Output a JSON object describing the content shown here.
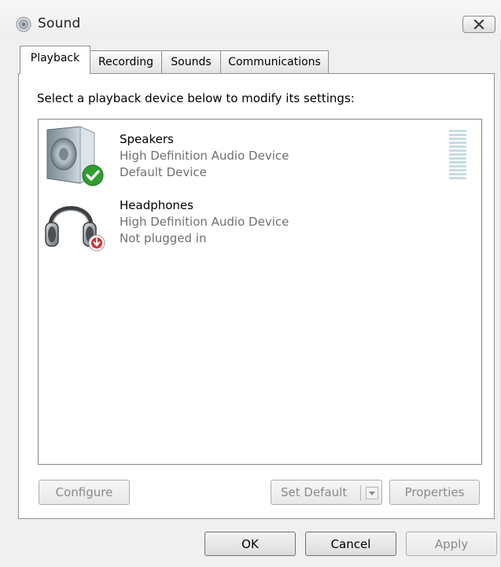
{
  "window": {
    "title": "Sound",
    "title_icon": "speaker-icon",
    "close_icon": "close-icon"
  },
  "tabs": [
    {
      "label": "Playback",
      "active": true
    },
    {
      "label": "Recording",
      "active": false
    },
    {
      "label": "Sounds",
      "active": false
    },
    {
      "label": "Communications",
      "active": false
    }
  ],
  "playback": {
    "instruction": "Select a playback device below to modify its settings:",
    "devices": [
      {
        "name": "Speakers",
        "description": "High Definition Audio Device",
        "status": "Default Device",
        "icon": "speaker-device-icon",
        "badge": "green-check-icon",
        "level_meter": true
      },
      {
        "name": "Headphones",
        "description": "High Definition Audio Device",
        "status": "Not plugged in",
        "icon": "headphones-device-icon",
        "badge": "red-down-arrow-icon",
        "level_meter": false
      }
    ],
    "buttons": {
      "configure": "Configure",
      "set_default": "Set Default",
      "properties": "Properties"
    }
  },
  "dialog_buttons": {
    "ok": "OK",
    "cancel": "Cancel",
    "apply": "Apply"
  },
  "colors": {
    "window_bg": "#f0f0f0",
    "list_bg": "#ffffff",
    "meter_fill": "#c5dde6",
    "badge_green": "#2f9e2f",
    "badge_red": "#d23030",
    "secondary_text": "#707070",
    "disabled_text": "#8a8a8a"
  }
}
